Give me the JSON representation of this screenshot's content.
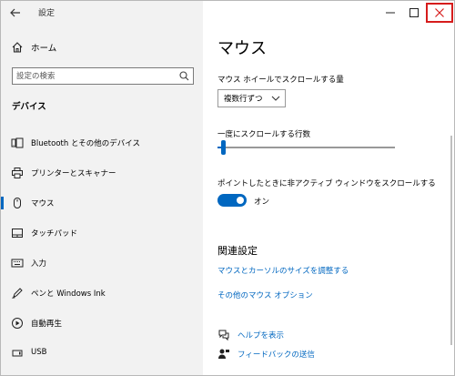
{
  "app": {
    "title": "設定"
  },
  "sidebar": {
    "home_label": "ホーム",
    "search_placeholder": "設定の検索",
    "section_title": "デバイス",
    "items": [
      {
        "label": "Bluetooth とその他のデバイス",
        "icon": "bluetooth-device-icon"
      },
      {
        "label": "プリンターとスキャナー",
        "icon": "printer-icon"
      },
      {
        "label": "マウス",
        "icon": "mouse-icon",
        "selected": true
      },
      {
        "label": "タッチパッド",
        "icon": "touchpad-icon"
      },
      {
        "label": "入力",
        "icon": "keyboard-icon"
      },
      {
        "label": "ペンと Windows Ink",
        "icon": "pen-icon"
      },
      {
        "label": "自動再生",
        "icon": "autoplay-icon"
      },
      {
        "label": "USB",
        "icon": "usb-icon"
      }
    ]
  },
  "main": {
    "title": "マウス",
    "wheel_scroll_label": "マウス ホイールでスクロールする量",
    "wheel_scroll_value": "複数行ずつ",
    "lines_label": "一度にスクロールする行数",
    "lines_slider_fraction": 0.03,
    "inactive_scroll_label": "ポイントしたときに非アクティブ ウィンドウをスクロールする",
    "inactive_scroll_state": "オン",
    "related_title": "関連設定",
    "related_links": [
      "マウスとカーソルのサイズを調整する",
      "その他のマウス オプション"
    ],
    "help_label": "ヘルプを表示",
    "feedback_label": "フィードバックの送信"
  },
  "colors": {
    "accent": "#0067c0",
    "close_highlight": "#d61c1c",
    "sidebar_bg": "#f2f2f2"
  }
}
